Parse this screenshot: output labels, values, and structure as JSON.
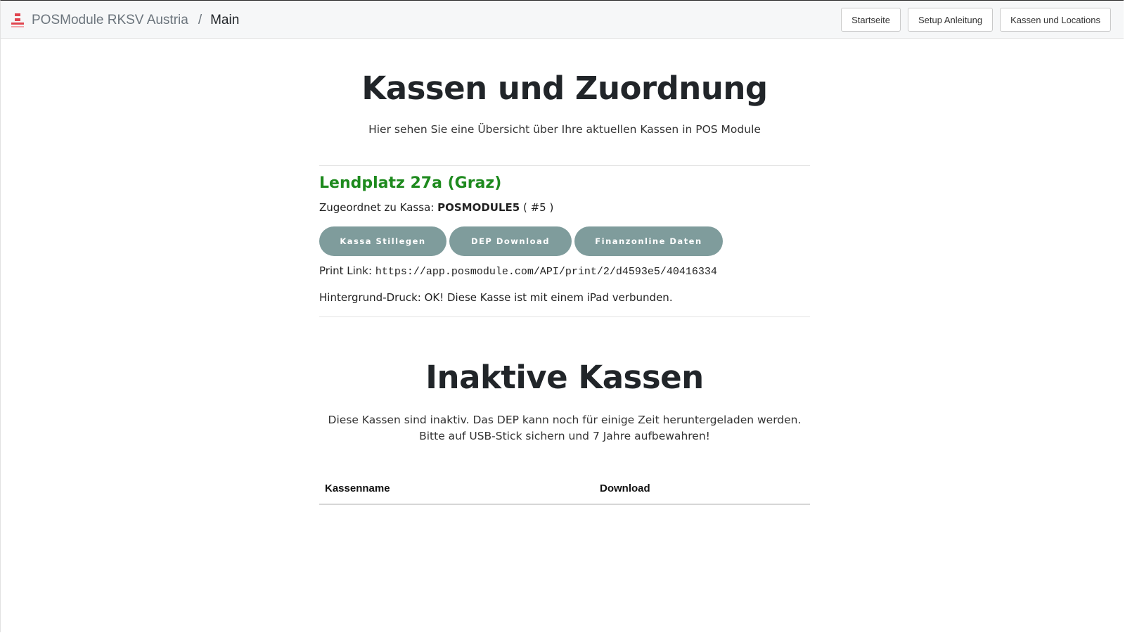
{
  "header": {
    "brand_name": "POSModule RKSV Austria",
    "separator": "/",
    "current_page": "Main",
    "nav": [
      {
        "label": "Startseite"
      },
      {
        "label": "Setup Anleitung"
      },
      {
        "label": "Kassen und Locations"
      }
    ]
  },
  "main": {
    "title": "Kassen und Zuordnung",
    "subtitle": "Hier sehen Sie eine Übersicht über Ihre aktuellen Kassen in POS Module",
    "location": {
      "name": "Lendplatz 27a (Graz)",
      "assigned_label": "Zugeordnet zu Kassa:",
      "register_name": "POSMODULE5",
      "register_number": "( #5 )",
      "buttons": [
        {
          "label": "Kassa Stillegen"
        },
        {
          "label": "DEP Download"
        },
        {
          "label": "Finanzonline Daten"
        }
      ],
      "print_link_label": "Print Link:",
      "print_link_url": "https://app.posmodule.com/API/print/2/d4593e5/40416334",
      "background_print": "Hintergrund-Druck: OK! Diese Kasse ist mit einem iPad verbunden."
    },
    "inactive": {
      "title": "Inaktive Kassen",
      "description": "Diese Kassen sind inaktiv. Das DEP kann noch für einige Zeit heruntergeladen werden. Bitte auf USB-Stick sichern und 7 Jahre aufbewahren!",
      "columns": [
        "Kassenname",
        "Download"
      ]
    }
  },
  "colors": {
    "location_name": "#1e8a1e",
    "pill_button": "#7f9c9c",
    "brand_icon": "#e0454f"
  },
  "icons": {
    "brand": "posmodule-logo-icon"
  }
}
